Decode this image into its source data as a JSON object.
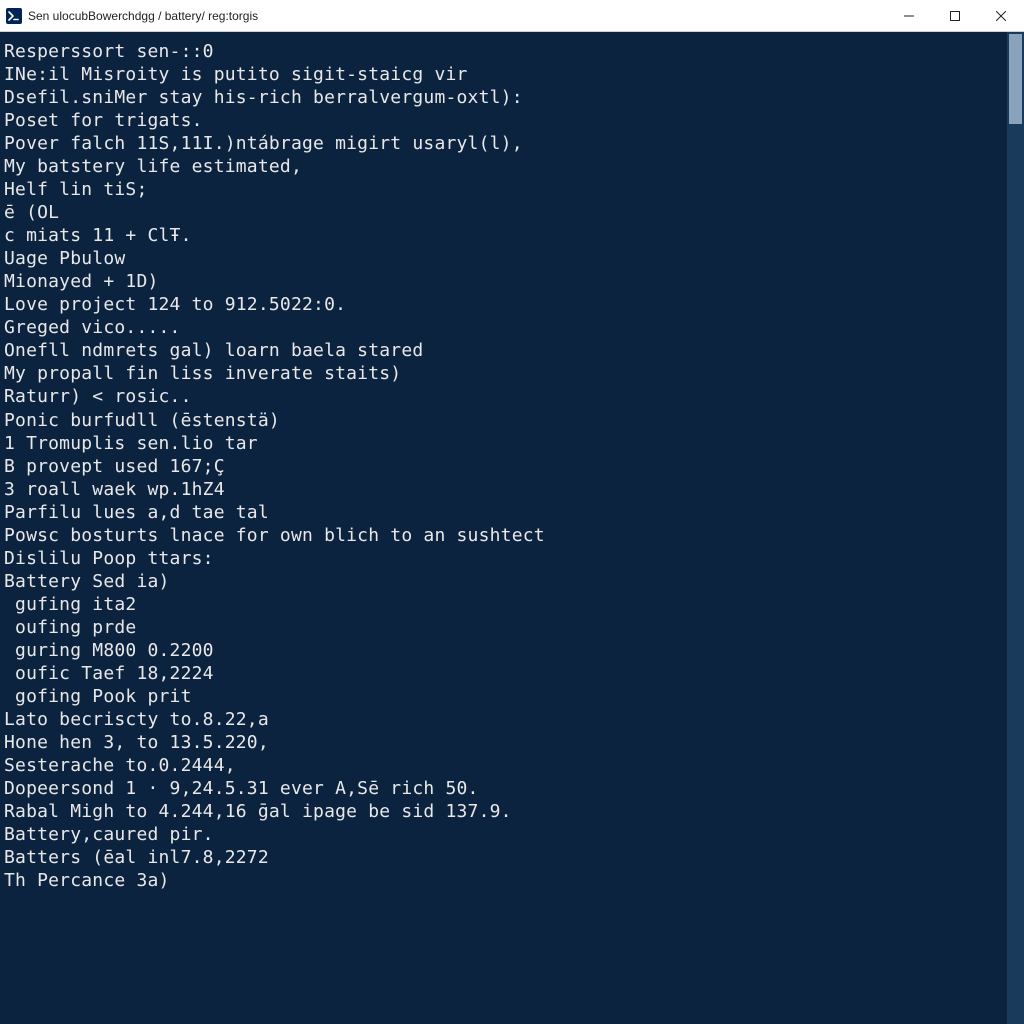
{
  "window": {
    "title": "Sen ulocubBowerchdgg / battery/ reg:torgis",
    "icon_name": "powershell-icon"
  },
  "controls": {
    "minimize": "–",
    "maximize": "□",
    "close": "×"
  },
  "terminal_lines": [
    "Resperssort sen-::0",
    "INe:il Misroity is putito sigit-staicg vir",
    "Dsefil.sniMer stay his-rich berralvergum-oxtl):",
    "",
    "Poset for trigats.",
    "Pover falch 11S,11I.)ntábrage migirt usaryl(l),",
    "",
    "My batstery life estimated,",
    "Helf lin tiS;",
    "ē (OL",
    "c miats 11 + ClŦ.",
    "",
    "Uage Pbulow",
    "Mionayed + 1D)",
    "Love project 124 to 912.5022:0.",
    "",
    "Greged vico.....",
    "Onefll ndmrets gal) loarn baela stared",
    "My propall fin liss inverate staits)",
    "",
    "Raturr) < rosic..",
    "Ponic burfudll (ēstenstä)",
    "1 Tromuplis sen.lio tar",
    "B provept used 167;Ç",
    "3 roall waek wp.1hZ4",
    "Parfilu lues a,d tae tal",
    "Powsc bosturts lnace for own blich to an sushtect",
    "Dislilu Poop ttars:",
    "Battery Sed ia)",
    " gufing ita2",
    " oufing prde",
    " guring M800 0.2200",
    " oufic Taef 18,2224",
    " gofing Pook prit",
    "Lato becriscty to.8.22,a",
    "Hone hen 3, to 13.5.220,",
    "Sesterache to.0.2444,",
    "Dopeersond 1 · 9,24.5.31 ever A,Sē rich 50.",
    "Rabal Migh to 4.244,16 ḡal ipage be sid 137.9.",
    "Battery,caured pir.",
    "Batters (ēal inl7.8,2272",
    "Th Percance 3a)"
  ]
}
